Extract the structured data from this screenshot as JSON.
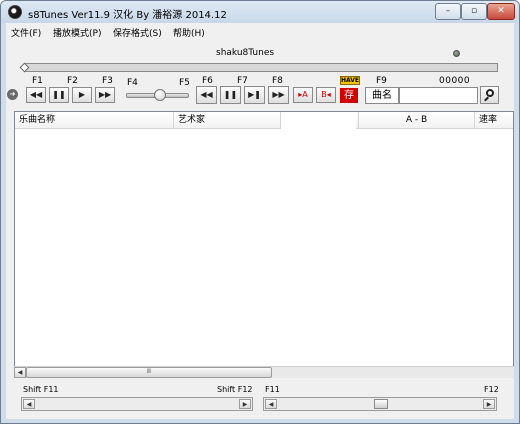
{
  "window": {
    "title": "s8Tunes Ver11.9  汉化 By 潘裕源 2014.12",
    "min_label": "–",
    "max_label": "▫",
    "close_label": "✕"
  },
  "menu": {
    "items": [
      {
        "label": "文件(F)"
      },
      {
        "label": "播放模式(P)"
      },
      {
        "label": "保存格式(S)"
      },
      {
        "label": "帮助(H)"
      }
    ]
  },
  "player": {
    "track_title": "shaku8Tunes",
    "seek_position": 0,
    "counter": "00000",
    "have_badge": "HAVE",
    "rec_label": "存",
    "volume_level": 0.55,
    "fkeys": [
      "F1",
      "F2",
      "F3",
      "F4",
      "F5",
      "F6",
      "F7",
      "F8",
      "F9"
    ],
    "buttons": {
      "rewind": "◀◀",
      "pause": "❚❚",
      "play": "▶",
      "forward": "▶▶",
      "f6": "◀◀",
      "f7": "❚❚",
      "f8": "▶❚",
      "f8b": "▶▶",
      "point_a": "▸A",
      "point_b": "B◂"
    }
  },
  "search": {
    "field_label": "曲名",
    "value": ""
  },
  "list": {
    "columns": [
      "乐曲名称",
      "艺术家",
      "",
      "A - B",
      "速率"
    ],
    "rows": []
  },
  "scrollbar": {
    "left_arrow": "◀",
    "right_arrow": "▶",
    "grip": "Ⅲ"
  },
  "range": {
    "left_start": "Shift F11",
    "left_end": "Shift F12",
    "right_start": "F11",
    "right_end": "F12"
  }
}
